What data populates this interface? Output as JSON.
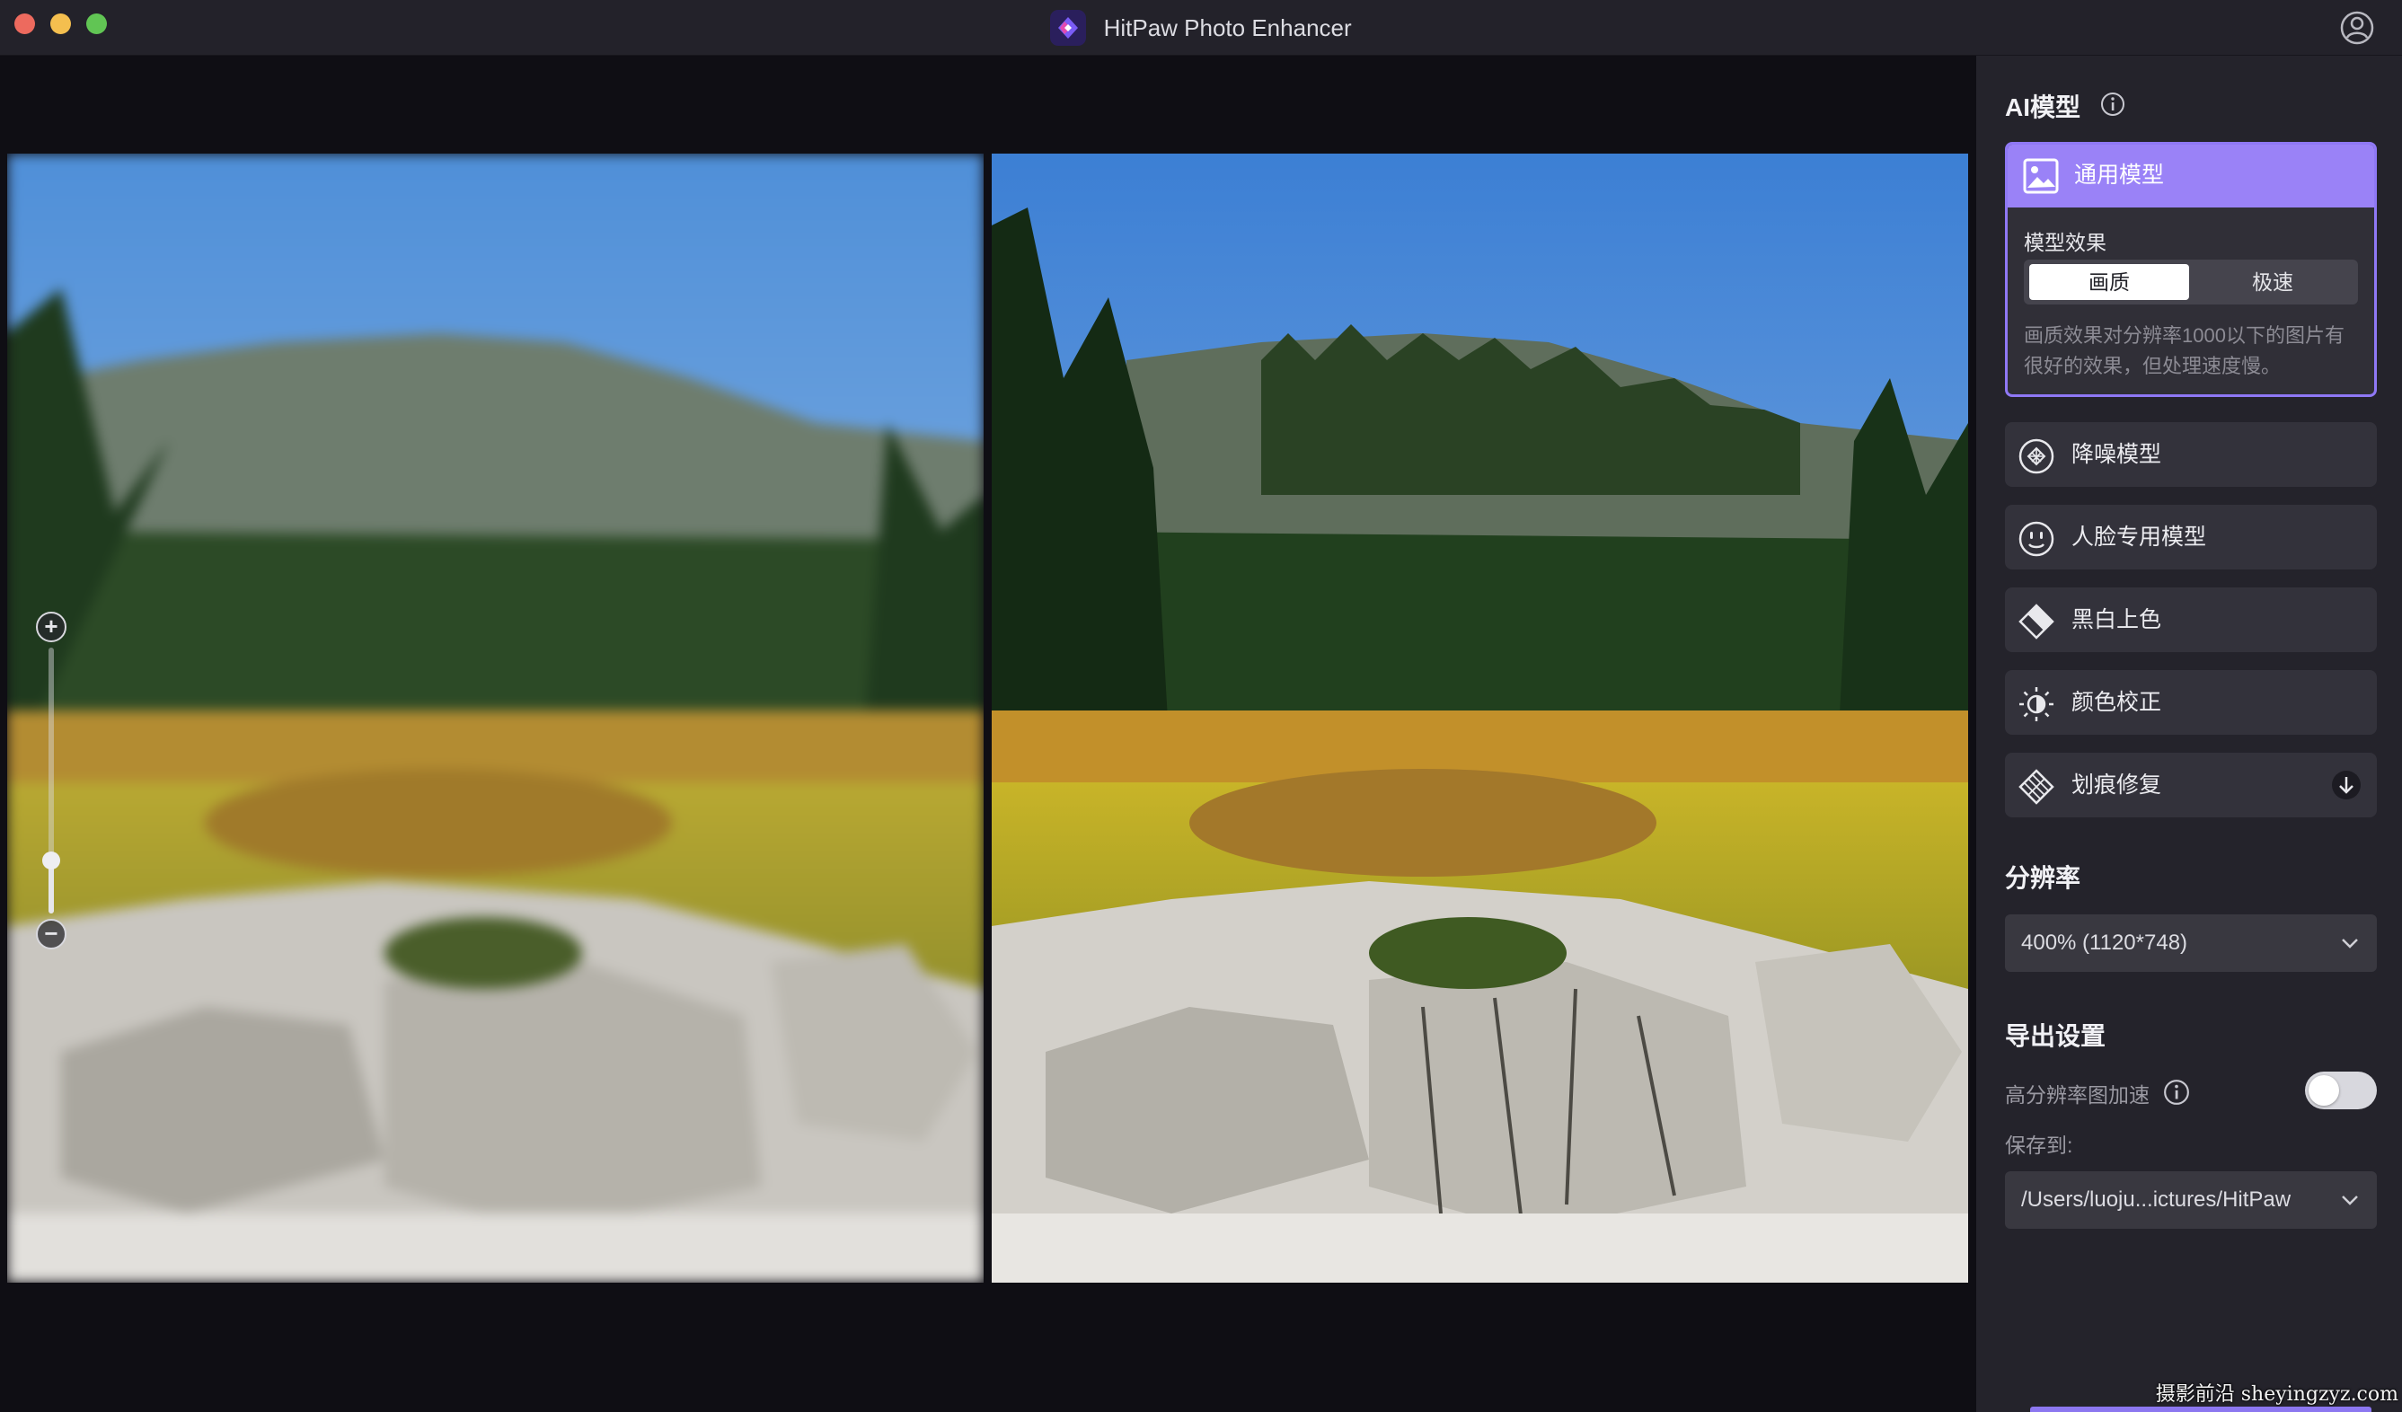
{
  "window": {
    "title": "HitPaw Photo Enhancer"
  },
  "ai_models": {
    "title": "AI模型",
    "active": {
      "label": "通用模型",
      "effect_label": "模型效果",
      "options": [
        "画质",
        "极速"
      ],
      "selected": "画质",
      "description": "画质效果对分辨率1000以下的图片有很好的效果，但处理速度慢。"
    },
    "items": [
      {
        "label": "降噪模型",
        "icon": "denoise-icon"
      },
      {
        "label": "人脸专用模型",
        "icon": "face-icon"
      },
      {
        "label": "黑白上色",
        "icon": "colorize-icon"
      },
      {
        "label": "颜色校正",
        "icon": "brightness-icon"
      },
      {
        "label": "划痕修复",
        "icon": "scratch-repair-icon",
        "download_icon": "download-icon"
      }
    ]
  },
  "resolution": {
    "title": "分辨率",
    "value": "400% (1120*748)"
  },
  "export": {
    "title": "导出设置",
    "hires_accel_label": "高分辨率图加速",
    "hires_accel_on": false,
    "save_to_label": "保存到:",
    "save_path": "/Users/luoju...ictures/HitPaw"
  },
  "zoom": {
    "plus": "+",
    "minus": "−",
    "level": 0.2
  },
  "watermark": "摄影前沿 sheyingzyz.com",
  "colors": {
    "accent": "#8f78f5",
    "panel_bg": "#24232b",
    "card_bg": "#33323b"
  }
}
